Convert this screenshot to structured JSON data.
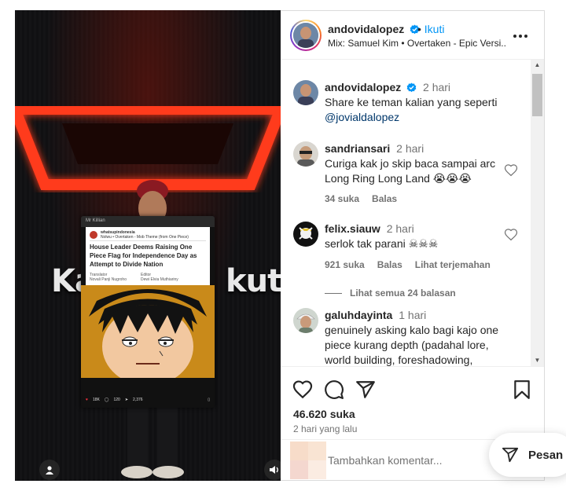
{
  "media": {
    "overlay_left": "Ka",
    "overlay_right": "kut",
    "embedded_post": {
      "top_label": "Mr Killian",
      "account": "whatsupindonesia",
      "audio": "Nolwu • Overtaken - Mob Theme (from One Piece)",
      "title": "House Leader Deems Raising One Piece Flag for Independence Day as Attempt to Divide Nation",
      "translator_label": "Translator",
      "translator_name": "Novali Panji Nugroho",
      "editor_label": "Editor",
      "editor_name": "Dewi Elvia Muthiariny",
      "likes": "18K",
      "comments": "120",
      "shares": "2,376"
    }
  },
  "header": {
    "username": "andovidalopez",
    "follow_label": "Ikuti",
    "dot": "•",
    "audio": "Mix: Samuel Kim • Overtaken - Epic Versi..."
  },
  "comments": [
    {
      "username": "andovidalopez",
      "time": "2 hari",
      "text": "Share ke teman kalian yang seperti",
      "mention": "@jovialdalopez",
      "verified": true
    },
    {
      "username": "sandriansari",
      "time": "2 hari",
      "text": "Curiga kak jo skip baca sampai arc Long Ring Long Land 😭😭😭",
      "likes": "34 suka",
      "reply": "Balas"
    },
    {
      "username": "felix.siauw",
      "time": "2 hari",
      "text": "serlok tak parani ☠☠☠",
      "likes": "921 suka",
      "reply": "Balas",
      "translate": "Lihat terjemahan",
      "view_replies": "Lihat semua 24 balasan"
    },
    {
      "username": "galuhdayinta",
      "time": "1 hari",
      "text": "genuinely asking kalo bagi kajo one piece kurang depth (padahal lore, world building, foreshadowing,"
    }
  ],
  "actions": {
    "likes": "46.620 suka",
    "posted": "2 hari yang lalu"
  },
  "add_comment": {
    "placeholder": "Tambahkan komentar..."
  },
  "message_button": {
    "label": "Pesan"
  },
  "icons": [
    "verified-icon",
    "more-icon",
    "heart-icon",
    "comment-icon",
    "share-icon",
    "bookmark-icon",
    "user-icon",
    "sound-icon",
    "send-icon"
  ],
  "colors": {
    "accent": "#0095f6",
    "verified": "#0095f6",
    "text": "#262626",
    "muted": "#737373"
  }
}
